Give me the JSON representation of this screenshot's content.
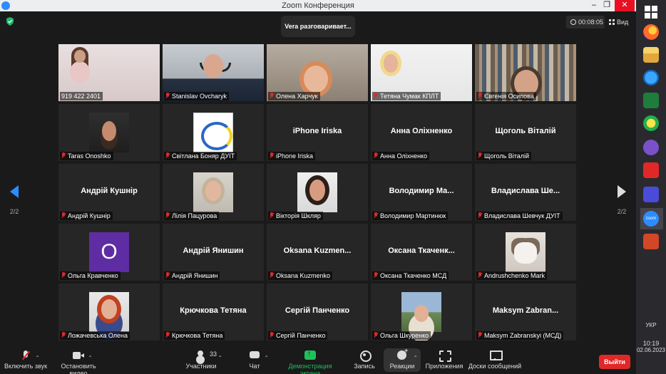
{
  "window": {
    "title": "Zoom Конференция",
    "controls": {
      "minimize": "‒",
      "restore": "❐",
      "close": "✕"
    }
  },
  "header": {
    "speaking": "Vera разговаривает...",
    "timer": "00:08:05",
    "view_label": "Вид"
  },
  "pager": {
    "left": "2/2",
    "right": "2/2"
  },
  "tiles": [
    {
      "label": "919 422 2401",
      "muted": false,
      "pic": "pic-woman-pink ph-video",
      "big": ""
    },
    {
      "label": "Stanislav Ovcharyk",
      "muted": true,
      "pic": "pic-man-office ph-video",
      "big": ""
    },
    {
      "label": "Олена Харчук",
      "muted": true,
      "pic": "pic-woman-room ph-video",
      "big": ""
    },
    {
      "label": "Тетяна Чумак КПЛТ",
      "muted": true,
      "pic": "pic-woman-blonde ph-video",
      "big": ""
    },
    {
      "label": "Євгенія Осипова",
      "muted": true,
      "pic": "pic-woman-books ph-video",
      "big": ""
    },
    {
      "label": "Taras Onoshko",
      "muted": true,
      "pic": "pic-man-beard ph-small",
      "big": ""
    },
    {
      "label": "Світлана Боняр ДУІТ",
      "muted": true,
      "pic": "pic-logo ph-small",
      "big": ""
    },
    {
      "label": "iPhone Iriska",
      "muted": true,
      "pic": "",
      "big": "iPhone Iriska"
    },
    {
      "label": "Анна Оліхненко",
      "muted": true,
      "pic": "",
      "big": "Анна Оліхненко"
    },
    {
      "label": "Щоголь Віталій",
      "muted": true,
      "pic": "",
      "big": "Щоголь Віталій"
    },
    {
      "label": "Андрій Кушнір",
      "muted": true,
      "pic": "",
      "big": "Андрій Кушнір"
    },
    {
      "label": "Лілія Пацурова",
      "muted": true,
      "pic": "pic-woman-glasses ph-small",
      "big": ""
    },
    {
      "label": "Вікторія Шкляр",
      "muted": true,
      "pic": "pic-woman-dark ph-small",
      "big": ""
    },
    {
      "label": "Володимир Мартинюк",
      "muted": true,
      "pic": "",
      "big": "Володимир Ма..."
    },
    {
      "label": "Владислава Шевчук ДУІТ",
      "muted": true,
      "pic": "",
      "big": "Владислава Ше..."
    },
    {
      "label": "Ольга Кравченко",
      "muted": true,
      "pic": "avatar",
      "big": "",
      "letter": "О"
    },
    {
      "label": "Андрій Янишин",
      "muted": true,
      "pic": "",
      "big": "Андрій Янишин"
    },
    {
      "label": "Oksana Kuzmenko",
      "muted": true,
      "pic": "",
      "big": "Oksana  Kuzmen..."
    },
    {
      "label": "Оксана Ткаченко МСД",
      "muted": true,
      "pic": "",
      "big": "Оксана  Ткаченк..."
    },
    {
      "label": "Andrushchenko Mark",
      "muted": true,
      "pic": "pic-cat ph-small",
      "big": ""
    },
    {
      "label": "Ложачевська Олена",
      "muted": true,
      "pic": "pic-woman-red ph-small",
      "big": ""
    },
    {
      "label": "Крючкова Тетяна",
      "muted": true,
      "pic": "",
      "big": "Крючкова Тетяна"
    },
    {
      "label": "Сергій Панченко",
      "muted": true,
      "pic": "",
      "big": "Сергій Панченко"
    },
    {
      "label": "Ольга Шкуренко",
      "muted": true,
      "pic": "pic-woman-outdoor ph-small",
      "big": ""
    },
    {
      "label": "Maksym Zabranskyi (МСД)",
      "muted": true,
      "pic": "",
      "big": "Maksym  Zabran..."
    }
  ],
  "toolbar": {
    "audio": "Включить звук",
    "video": "Остановить видео",
    "participants": "Участники",
    "participants_count": "33",
    "chat": "Чат",
    "share": "Демонстрация экрана",
    "record": "Запись",
    "reactions": "Реакции",
    "apps": "Приложения",
    "whiteboard": "Доски сообщений",
    "leave": "Выйти",
    "caret": "⌃"
  },
  "taskbar": {
    "zoom_label": "zoom",
    "lang": "УКР",
    "time": "10:19",
    "date": "02.06.2023"
  }
}
